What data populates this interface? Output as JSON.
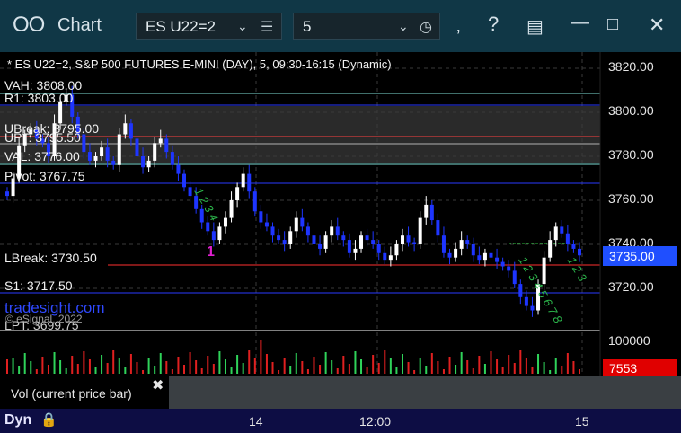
{
  "window": {
    "title": "Chart",
    "symbol": "ES U22=2",
    "interval": "5"
  },
  "chart": {
    "title": "* ES U22=2, S&P 500 FUTURES E-MINI (DAY), 5, 09:30-16:15 (Dynamic)",
    "levels": [
      {
        "key": "vah",
        "text": "VAH: 3808.00"
      },
      {
        "key": "r1",
        "text": "R1: 3803.00"
      },
      {
        "key": "ubreak",
        "text": "UBreak: 3795.00"
      },
      {
        "key": "upt",
        "text": "UPT: 3795.50"
      },
      {
        "key": "val",
        "text": "VAL: 3776.00"
      },
      {
        "key": "pivot",
        "text": "Pivot: 3767.75"
      },
      {
        "key": "lbreak",
        "text": "LBreak: 3730.50"
      },
      {
        "key": "s1",
        "text": "S1: 3717.50"
      },
      {
        "key": "lpt",
        "text": "LPT: 3699.75"
      }
    ],
    "watermark": "tradesight.com",
    "copyright": "© eSignal, 2022",
    "y_axis": [
      "3820.00",
      "3800.00",
      "3780.00",
      "3760.00",
      "3740.00",
      "3720.00"
    ],
    "last_price": "3735.00",
    "x_axis": [
      "14",
      "12:00",
      "15"
    ],
    "marker": "1"
  },
  "volume": {
    "label": "Vol (current price bar)",
    "max_label": "100000",
    "current": "7553"
  },
  "statusbar": {
    "mode": "Dyn"
  },
  "chart_data": {
    "type": "candlestick",
    "title": "* ES U22=2, S&P 500 FUTURES E-MINI (DAY), 5, 09:30-16:15 (Dynamic)",
    "ylim": [
      3700,
      3828
    ],
    "close_series": [
      3762,
      3770,
      3785,
      3790,
      3792,
      3788,
      3786,
      3780,
      3795,
      3805,
      3808,
      3798,
      3790,
      3782,
      3778,
      3780,
      3784,
      3778,
      3776,
      3790,
      3795,
      3788,
      3780,
      3775,
      3778,
      3786,
      3788,
      3782,
      3776,
      3772,
      3766,
      3762,
      3756,
      3750,
      3746,
      3742,
      3748,
      3752,
      3760,
      3766,
      3772,
      3764,
      3755,
      3750,
      3748,
      3744,
      3742,
      3740,
      3746,
      3752,
      3748,
      3744,
      3740,
      3738,
      3744,
      3748,
      3744,
      3742,
      3736,
      3738,
      3744,
      3742,
      3740,
      3736,
      3733,
      3735,
      3740,
      3744,
      3741,
      3740,
      3752,
      3758,
      3751,
      3744,
      3736,
      3734,
      3738,
      3742,
      3740,
      3735,
      3733,
      3736,
      3734,
      3732,
      3730,
      3728,
      3722,
      3716,
      3712,
      3710,
      3722,
      3734,
      3742,
      3748,
      3745,
      3740,
      3738,
      3735
    ],
    "levels": {
      "VAH": 3808.0,
      "R1": 3803.0,
      "UBreak": 3795.0,
      "UPT": 3795.5,
      "VAL": 3776.0,
      "Pivot": 3767.75,
      "LBreak": 3730.5,
      "S1": 3717.5,
      "LPT": 3699.75
    },
    "last": 3735.0,
    "volume_current": 7553
  }
}
